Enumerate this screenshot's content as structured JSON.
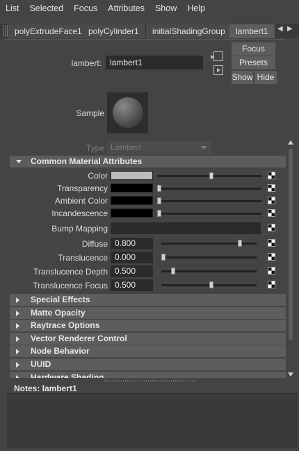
{
  "menu": [
    "List",
    "Selected",
    "Focus",
    "Attributes",
    "Show",
    "Help"
  ],
  "tabs": [
    {
      "label": "polyExtrudeFace1",
      "active": false
    },
    {
      "label": "polyCylinder1",
      "active": false
    },
    {
      "label": "initialShadingGroup",
      "active": false
    },
    {
      "label": "lambert1",
      "active": true
    }
  ],
  "node": {
    "type_label": "lambert:",
    "name": "lambert1"
  },
  "buttons": {
    "focus": "Focus",
    "presets": "Presets",
    "show": "Show",
    "hide": "Hide"
  },
  "sample_label": "Sample",
  "type_field": {
    "label": "Type",
    "value": "Lambert"
  },
  "common": {
    "title": "Common Material Attributes",
    "color_rows": [
      {
        "label": "Color",
        "swatch": "#bcbcbc",
        "level": 0.5
      },
      {
        "label": "Transparency",
        "swatch": "#000000",
        "level": 0.0
      },
      {
        "label": "Ambient Color",
        "swatch": "#000000",
        "level": 0.0
      },
      {
        "label": "Incandescence",
        "swatch": "#000000",
        "level": 0.0
      }
    ],
    "bump_label": "Bump Mapping",
    "value_rows": [
      {
        "label": "Diffuse",
        "value": "0.800",
        "level": 0.8
      },
      {
        "label": "Translucence",
        "value": "0.000",
        "level": 0.0
      },
      {
        "label": "Translucence Depth",
        "value": "0.500",
        "level": 0.1
      },
      {
        "label": "Translucence Focus",
        "value": "0.500",
        "level": 0.5
      }
    ]
  },
  "sections": [
    "Special Effects",
    "Matte Opacity",
    "Raytrace Options",
    "Vector Renderer Control",
    "Node Behavior",
    "UUID",
    "Hardware Shading"
  ],
  "notes": {
    "label": "Notes:  lambert1"
  },
  "icons": {
    "tab_left": "triangle-left",
    "tab_right": "triangle-right",
    "map": "checker-map"
  }
}
